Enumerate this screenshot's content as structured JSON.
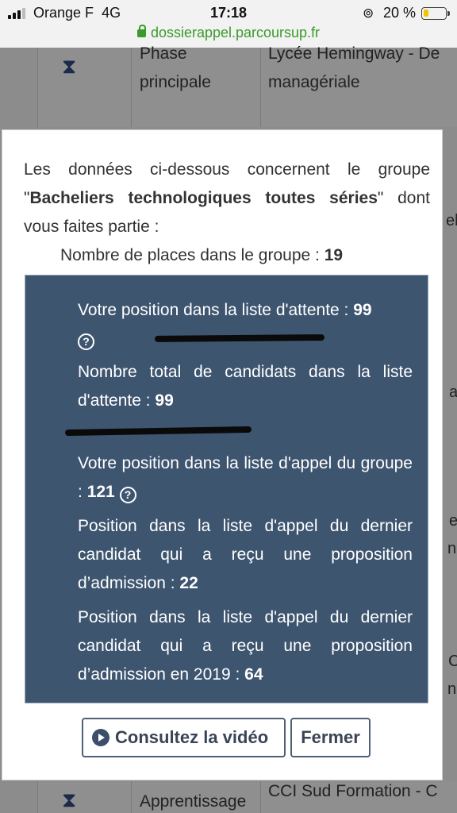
{
  "status_bar": {
    "carrier": "Orange F",
    "network": "4G",
    "time": "17:18",
    "battery": "20 %",
    "url": "dossierappel.parcoursup.fr"
  },
  "background_rows": [
    {
      "col2": [
        "Phase",
        "principale"
      ],
      "col3": [
        "Lycée Hemingway - De",
        "managériale"
      ]
    },
    {
      "col2": [
        "Apprentissage"
      ],
      "col3": [
        "CCI Sud Formation - C"
      ]
    }
  ],
  "background_fragments": [
    "el",
    "a",
    "e",
    "nn",
    "C",
    "nn"
  ],
  "modal": {
    "intro_before": "Les données ci-dessous concernent le groupe",
    "group_name": "Bacheliers technologiques toutes séries",
    "intro_after": "dont vous faites partie :",
    "places_label": "Nombre de places dans le groupe :",
    "places_value": "19",
    "stats": {
      "waitlist_position_label": "Votre position dans la liste d'attente :",
      "waitlist_position_value": "99",
      "waitlist_total_label": "Nombre total de candidats dans la liste d'attente :",
      "waitlist_total_value": "99",
      "call_position_label": "Votre position dans la liste d'appel du groupe :",
      "call_position_value": "121",
      "last_admitted_label": "Position dans la liste d'appel du dernier candidat qui a reçu une proposition d’admission :",
      "last_admitted_value": "22",
      "last_admitted_2019_label": "Position dans la liste d'appel du dernier candidat qui a reçu une proposition d’admission en 2019 :",
      "last_admitted_2019_value": "64"
    },
    "video_button": "Consultez la vidéo",
    "close_button": "Fermer"
  },
  "colors": {
    "stats_panel": "#3e5570",
    "button_border": "#4d6078",
    "url_green": "#3a9a2a"
  }
}
